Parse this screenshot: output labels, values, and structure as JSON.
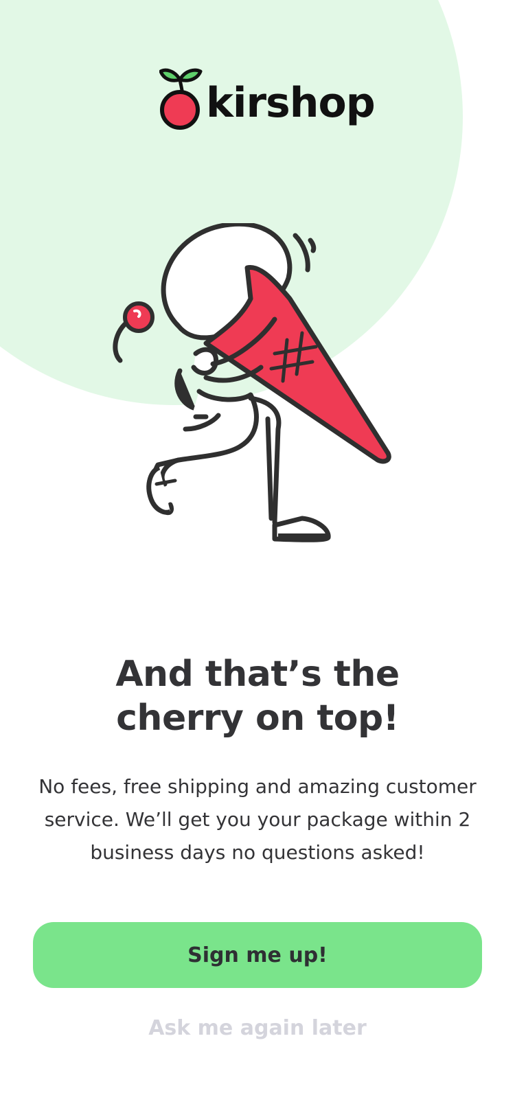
{
  "brand": {
    "name": "kirshop",
    "logo_icon": "cherry-icon"
  },
  "illustration": {
    "icon": "person-carrying-ice-cream-illustration"
  },
  "headline": {
    "line1": "And that’s the",
    "line2": "cherry on top!"
  },
  "body": {
    "line1": "No fees, free shipping and amazing customer",
    "line2": "service. We’ll get you your package within 2",
    "line3": "business days no questions asked!"
  },
  "actions": {
    "primary_label": "Sign me up!",
    "secondary_label": "Ask me again later"
  },
  "colors": {
    "background": "#ffffff",
    "circle": "#e2f8e6",
    "accent_green": "#7ae48b",
    "cherry_red": "#ef3b54",
    "text_dark": "#333336",
    "text_muted": "#d4d4dc"
  }
}
